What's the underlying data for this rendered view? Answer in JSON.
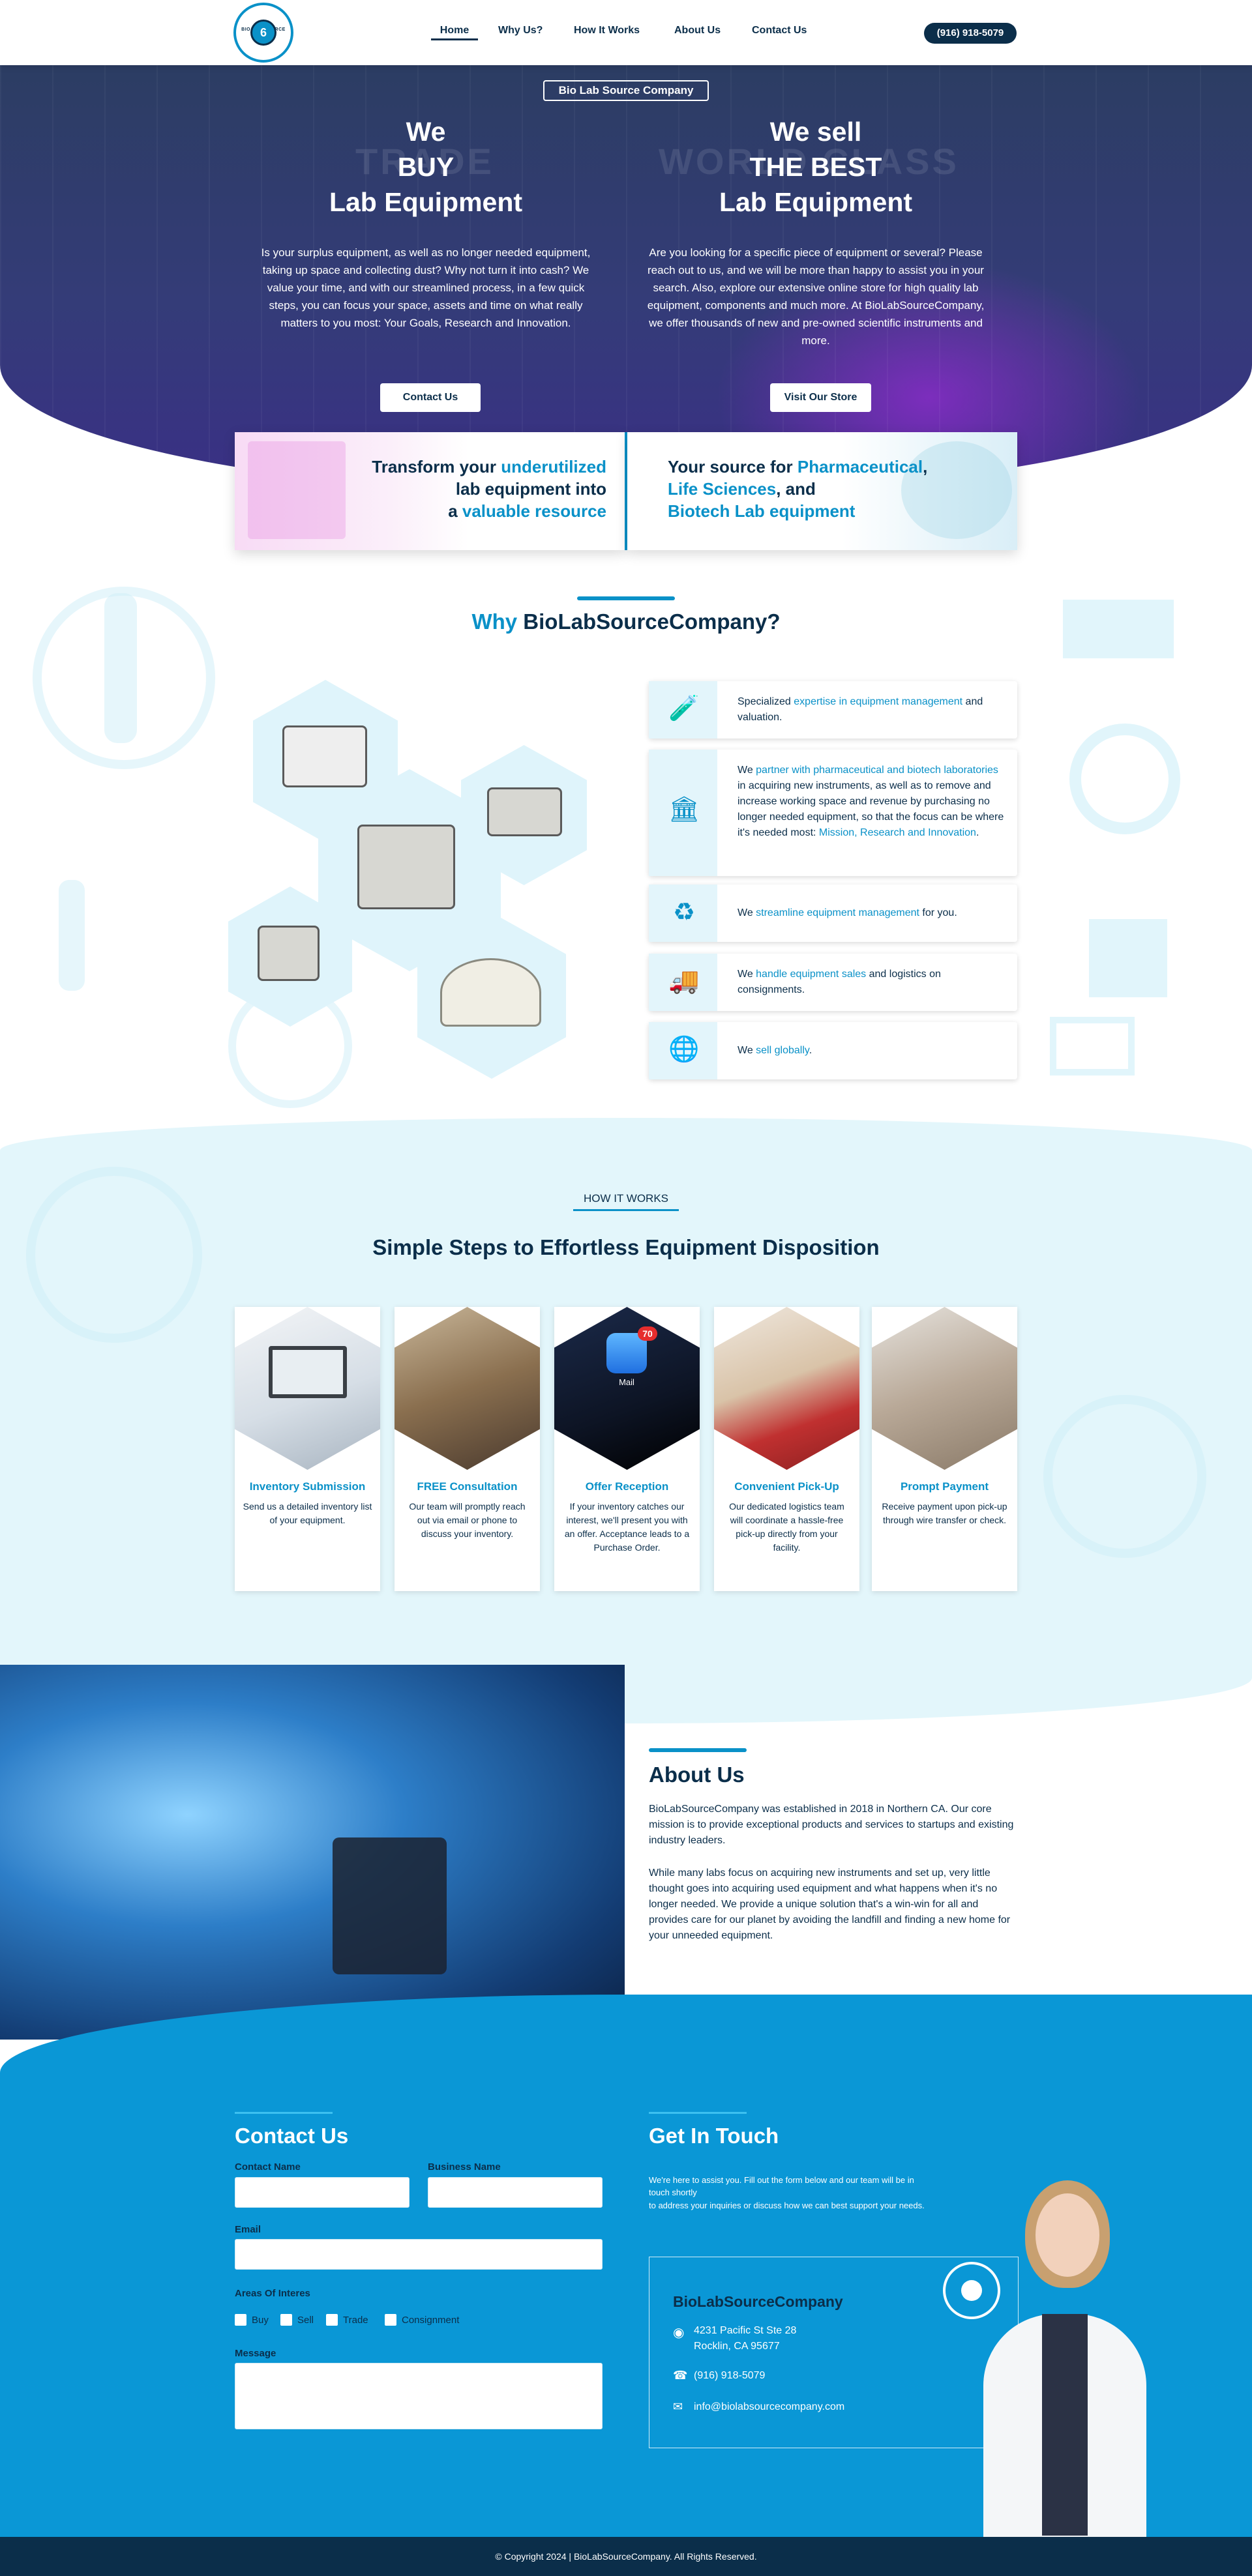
{
  "header": {
    "logo_text": "BIO LAB SOURCE COMPANY",
    "nav": [
      "Home",
      "Why Us?",
      "How It Works",
      "About Us",
      "Contact Us"
    ],
    "phone": "(916) 918-5079"
  },
  "hero": {
    "badge": "Bio Lab Source Company",
    "ghost_left": "TRADE",
    "ghost_right": "WORLD CLASS",
    "left": {
      "line1": "We",
      "line2": "BUY",
      "line3": "Lab Equipment",
      "text": "Is your surplus equipment, as well as no longer needed equipment, taking up space and collecting dust? Why not turn it into cash? We value your time, and with our streamlined process, in a few quick steps, you can focus your space, assets and time on what really matters to you most: Your Goals, Research and Innovation.",
      "button": "Contact Us"
    },
    "right": {
      "line1": "We sell",
      "line2": "THE BEST",
      "line3": "Lab Equipment",
      "text": "Are you looking for a specific piece of equipment or several? Please reach out to us, and we will be more than happy to assist you in your search. Also, explore our extensive online store for high quality lab equipment, components and much more. At BioLabSourceCompany, we offer thousands of new and pre-owned scientific instruments and more.",
      "button": "Visit Our Store"
    }
  },
  "cards": {
    "left": {
      "a": "Transform your ",
      "b": "underutilized",
      "c": "lab equipment into",
      "d": "a ",
      "e": "valuable resource"
    },
    "right": {
      "a": "Your source for ",
      "b": "Pharmaceutical",
      "c": ",",
      "d": "Life Sciences",
      "e": ", and",
      "f": "Biotech Lab equipment"
    }
  },
  "why": {
    "title_a": "Why ",
    "title_b": "BioLabSourceCompany?",
    "features": [
      {
        "icon": "pipette-tag-icon",
        "pre": "Specialized ",
        "hl": "expertise in equipment management",
        "post": " and valuation."
      },
      {
        "icon": "bank-to-lab-icon",
        "pre": "We ",
        "hl": "partner with pharmaceutical and biotech laboratories",
        "post": " in acquiring new instruments, as well as to remove and increase working space and revenue by purchasing no longer needed equipment, so that the focus can be where it's needed most: ",
        "hl2": "Mission, Research and Innovation",
        "post2": "."
      },
      {
        "icon": "recycle-pipette-icon",
        "pre": "We ",
        "hl": "streamline equipment management",
        "post": " for you."
      },
      {
        "icon": "truck-cart-icon",
        "pre": "We ",
        "hl": "handle equipment sales",
        "post": " and logistics on consignments."
      },
      {
        "icon": "globe-icon",
        "pre": "We ",
        "hl": "sell globally",
        "post": "."
      }
    ]
  },
  "how": {
    "label": "HOW IT WORKS",
    "title": "Simple Steps to Effortless Equipment Disposition",
    "steps": [
      {
        "title": "Inventory Submission",
        "text": "Send us a detailed inventory list of your equipment."
      },
      {
        "title": "FREE Consultation",
        "text": "Our team will promptly reach out via email or phone to discuss your inventory."
      },
      {
        "title": "Offer Reception",
        "text": "If your inventory catches our interest, we'll present you with an offer. Acceptance leads to a Purchase Order."
      },
      {
        "title": "Convenient Pick-Up",
        "text": "Our dedicated logistics team will coordinate a hassle-free pick-up directly from your facility."
      },
      {
        "title": "Prompt Payment",
        "text": "Receive payment upon pick-up through wire transfer or check."
      }
    ],
    "mail_badge": "70",
    "mail_label": "Mail"
  },
  "about": {
    "title": "About Us",
    "p1": "BioLabSourceCompany was established in 2018 in Northern CA. Our core mission is to provide exceptional products and services to startups and existing industry leaders.",
    "p2": "While many labs focus on acquiring new instruments and set up, very little thought goes into acquiring used equipment and what happens when it's no longer needed. We provide a unique solution that's a win-win for all and provides care for our planet by avoiding the landfill and finding a new home for your unneeded equipment."
  },
  "contact": {
    "title": "Contact Us",
    "contact_name": "Contact Name",
    "business_name": "Business Name",
    "email": "Email",
    "areas": "Areas Of Interes",
    "options": [
      "Buy",
      "Sell",
      "Trade",
      "Consignment"
    ],
    "message": "Message"
  },
  "touch": {
    "title": "Get In Touch",
    "text1": "We're here to assist you. Fill out the form below and our team will be in touch shortly",
    "text2": "to address your inquiries or discuss how we can best support your needs.",
    "company": "BioLabSourceCompany",
    "addr1": "4231 Pacific St Ste 28",
    "addr2": "Rocklin, CA 95677",
    "phone": "(916) 918-5079",
    "email": "info@biolabsourcecompany.com"
  },
  "footer": "© Copyright 2024 | BioLabSourceCompany. All Rights Reserved.",
  "colors": {
    "primary": "#0a91c8",
    "navy": "#0b2e4a",
    "contact_bg": "#0a97d6",
    "light_bg": "#e3f6fb"
  }
}
